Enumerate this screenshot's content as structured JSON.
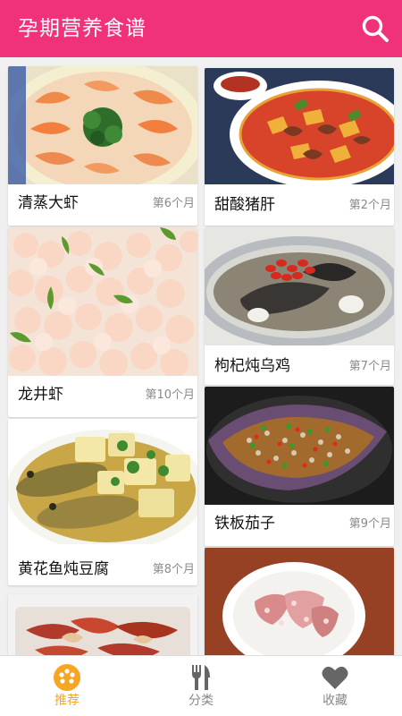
{
  "header": {
    "title": "孕期营养食谱",
    "search_icon": "search-icon",
    "color": "#f0327a"
  },
  "recipes_left": [
    {
      "name": "清蒸大虾",
      "age": "第6个月",
      "image": "steamed shrimp"
    },
    {
      "name": "龙井虾",
      "age": "第10个月",
      "image": "longjing shrimp"
    },
    {
      "name": "黄花鱼炖豆腐",
      "age": "第8个月",
      "image": "croaker tofu stew"
    },
    {
      "name": "",
      "age": "",
      "image": "braised dish"
    }
  ],
  "recipes_right": [
    {
      "name": "甜酸猪肝",
      "age": "第2个月",
      "image": "sweet and sour pork liver"
    },
    {
      "name": "枸杞炖乌鸡",
      "age": "第7个月",
      "image": "goji black chicken soup"
    },
    {
      "name": "铁板茄子",
      "age": "第9个月",
      "image": "sizzling eggplant"
    },
    {
      "name": "",
      "age": "",
      "image": "minced meat bowl"
    }
  ],
  "tabbar": {
    "tabs": [
      {
        "label": "推荐",
        "icon": "recommend-icon",
        "active": true
      },
      {
        "label": "分类",
        "icon": "fork-knife-icon",
        "active": false
      },
      {
        "label": "收藏",
        "icon": "heart-icon",
        "active": false
      }
    ],
    "active_color": "#f5a623",
    "inactive_color": "#888888"
  }
}
